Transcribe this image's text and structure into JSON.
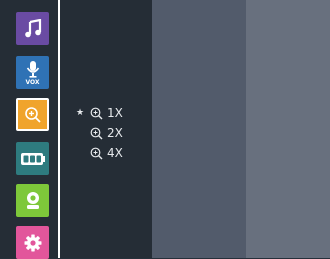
{
  "sidebar": {
    "items": [
      {
        "name": "music",
        "icon": "music-note-icon",
        "color": "#6a4ba3",
        "selected": false
      },
      {
        "name": "vox",
        "icon": "microphone-icon",
        "label": "VOX",
        "color": "#2f72b5",
        "selected": false
      },
      {
        "name": "zoom",
        "icon": "zoom-icon",
        "color": "#f0a42c",
        "selected": true
      },
      {
        "name": "battery-display",
        "icon": "battery-icon",
        "color": "#2e7b7f",
        "selected": false
      },
      {
        "name": "camera",
        "icon": "baby-monitor-camera-icon",
        "color": "#7ec83a",
        "selected": false
      },
      {
        "name": "settings",
        "icon": "gear-icon",
        "color": "#e2569b",
        "selected": false
      }
    ]
  },
  "zoom_menu": {
    "options": [
      {
        "label": "1X",
        "selected": true,
        "marker": "★"
      },
      {
        "label": "2X",
        "selected": false,
        "marker": ""
      },
      {
        "label": "4X",
        "selected": false,
        "marker": ""
      }
    ]
  }
}
